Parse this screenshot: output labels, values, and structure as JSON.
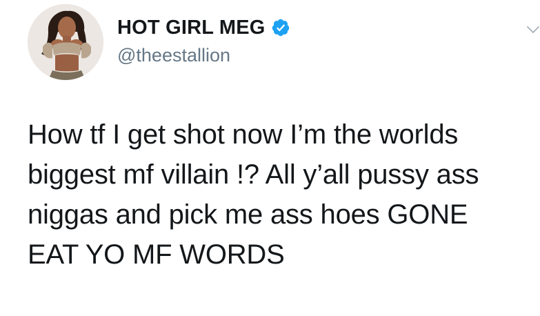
{
  "tweet": {
    "author": {
      "display_name": "HOT GIRL MEG",
      "handle": "@theestallion",
      "verified": true,
      "verified_color": "#1da1f2",
      "avatar_icon": "profile-photo"
    },
    "menu_icon": "chevron-down-icon",
    "text": "How tf I get shot now I’m the worlds\nbiggest mf villain !? All y’all pussy ass\nniggas and pick me ass hoes GONE\nEAT YO MF WORDS"
  },
  "colors": {
    "text": "#14171a",
    "secondary": "#657786",
    "background": "#ffffff"
  }
}
